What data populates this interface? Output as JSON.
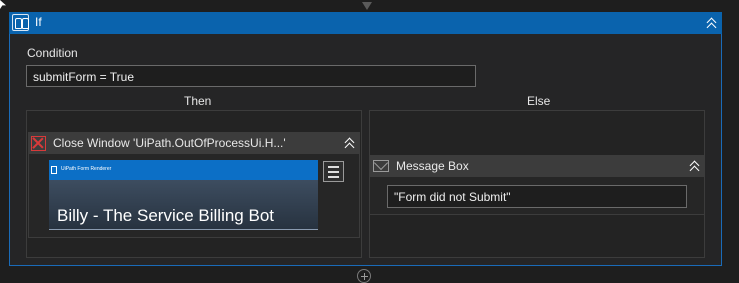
{
  "if_activity": {
    "title": "If",
    "condition_label": "Condition",
    "condition_value": "submitForm = True",
    "then_label": "Then",
    "else_label": "Else"
  },
  "then_activity": {
    "title": "Close Window 'UiPath.OutOfProcessUi.H...'",
    "preview_app_name": "UiPath Form Renderer",
    "preview_text": "Billy - The Service Billing Bot"
  },
  "else_activity": {
    "title": "Message Box",
    "message_value": "\"Form did not Submit\""
  },
  "icons": {
    "if_icon": "binoculars-icon",
    "collapse_icon": "double-chevron-up-icon",
    "close_window_icon": "close-window-icon",
    "menu_icon": "hamburger-menu-icon",
    "message_icon": "envelope-icon",
    "add_icon": "plus-circle-icon"
  },
  "colors": {
    "header_accent": "#0a63ad",
    "background": "#1e1e1e",
    "close_icon_red": "#d83a3a"
  }
}
